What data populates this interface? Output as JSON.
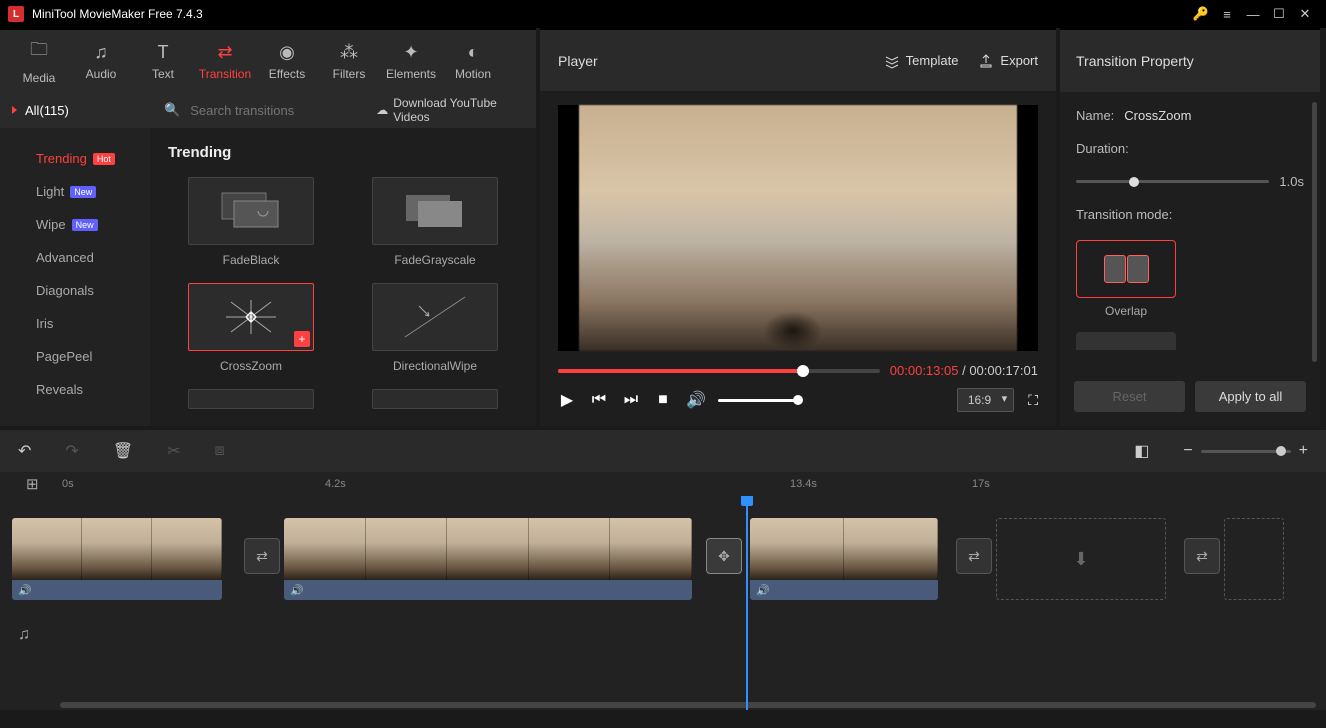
{
  "title": "MiniTool MovieMaker Free 7.4.3",
  "toolbar": {
    "media": "Media",
    "audio": "Audio",
    "text": "Text",
    "transition": "Transition",
    "effects": "Effects",
    "filters": "Filters",
    "elements": "Elements",
    "motion": "Motion"
  },
  "categories": {
    "header": "All(115)",
    "items": [
      {
        "label": "Trending",
        "badge": "Hot",
        "active": true
      },
      {
        "label": "Light",
        "badge": "New"
      },
      {
        "label": "Wipe",
        "badge": "New"
      },
      {
        "label": "Advanced"
      },
      {
        "label": "Diagonals"
      },
      {
        "label": "Iris"
      },
      {
        "label": "PagePeel"
      },
      {
        "label": "Reveals"
      }
    ]
  },
  "search": {
    "placeholder": "Search transitions",
    "download": "Download YouTube Videos"
  },
  "section": "Trending",
  "grid": {
    "fadeblack": "FadeBlack",
    "fadegray": "FadeGrayscale",
    "crosszoom": "CrossZoom",
    "dirwipe": "DirectionalWipe"
  },
  "player": {
    "title": "Player",
    "template": "Template",
    "export": "Export",
    "cur": "00:00:13:05",
    "sep": " / ",
    "total": "00:00:17:01",
    "ratio": "16:9"
  },
  "property": {
    "title": "Transition Property",
    "name_label": "Name:",
    "name_value": "CrossZoom",
    "duration_label": "Duration:",
    "duration_value": "1.0s",
    "mode_label": "Transition mode:",
    "mode_overlap": "Overlap",
    "reset": "Reset",
    "apply": "Apply to all"
  },
  "ruler": {
    "t0": "0s",
    "t1": "4.2s",
    "t2": "13.4s",
    "t3": "17s"
  }
}
